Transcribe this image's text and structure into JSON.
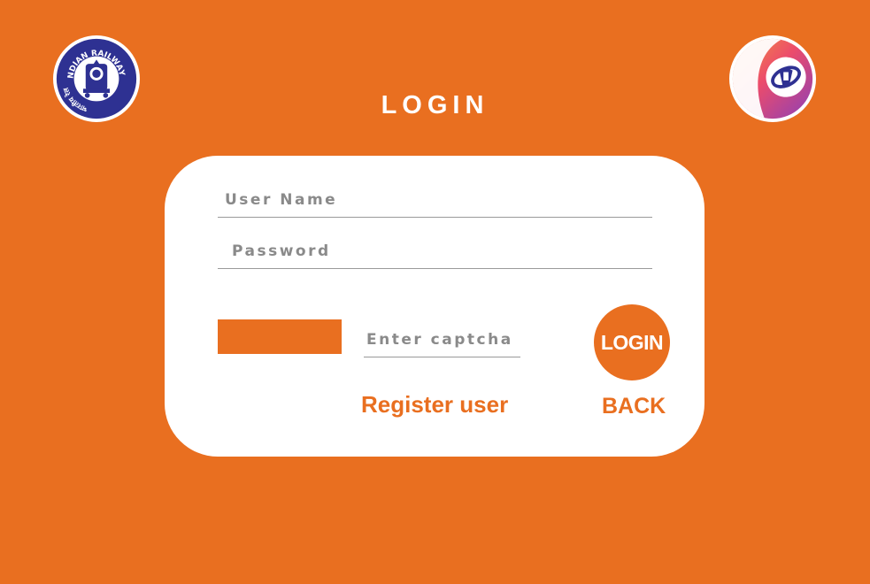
{
  "header": {
    "title": "LOGIN",
    "left_logo": {
      "icon": "indian-railways-emblem-icon",
      "text_top": "INDIAN RAILWAYS",
      "text_left": "भारतीय रेल",
      "colors": {
        "primary": "#2e3192",
        "background": "#ffffff"
      }
    },
    "right_logo": {
      "icon": "irctc-logo-icon",
      "colors": {
        "primary": "#2e3192",
        "accent_pink": "#ec4c6b",
        "accent_purple": "#8b3fb8",
        "accent_orange": "#f59a3a"
      }
    }
  },
  "form": {
    "username": {
      "value": "",
      "placeholder": "User Name"
    },
    "password": {
      "value": "",
      "placeholder": "Password"
    },
    "captcha": {
      "value": "",
      "placeholder": "Enter captcha"
    },
    "login_label": "LOGIN",
    "register_label": "Register user",
    "back_label": "BACK"
  },
  "colors": {
    "background": "#e96f20",
    "card": "#ffffff",
    "accent": "#e96f20",
    "placeholder_text": "#8a8a8a",
    "field_underline": "#9a9a9a"
  }
}
